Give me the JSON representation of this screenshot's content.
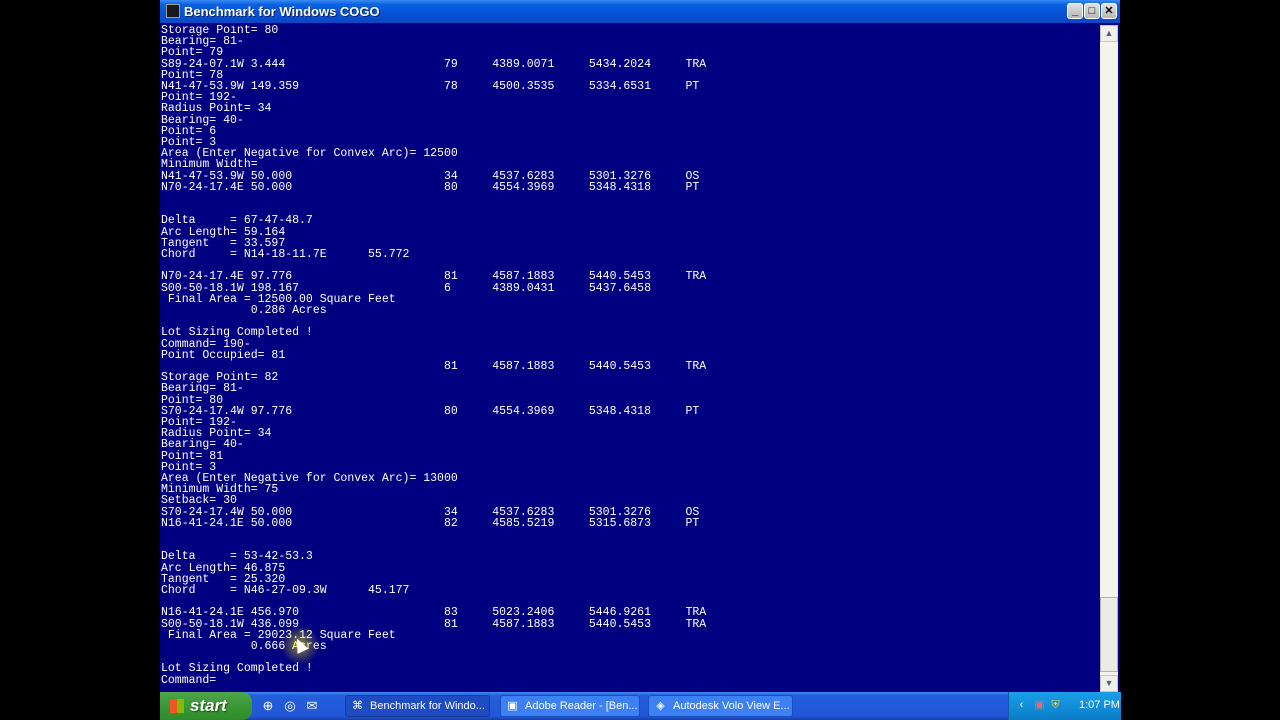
{
  "window": {
    "title": "Benchmark for Windows COGO"
  },
  "titlebar": {
    "minimize": "_",
    "maximize": "□",
    "close": "✕"
  },
  "console": {
    "lines": [
      "Storage Point= 80",
      "Bearing= 81-",
      "Point= 79",
      "S89-24-07.1W 3.444                       79     4389.0071     5434.2024     TRA",
      "Point= 78",
      "N41-47-53.9W 149.359                     78     4500.3535     5334.6531     PT",
      "Point= 192-",
      "Radius Point= 34",
      "Bearing= 40-",
      "Point= 6",
      "Point= 3",
      "Area (Enter Negative for Convex Arc)= 12500",
      "Minimum Width=",
      "N41-47-53.9W 50.000                      34     4537.6283     5301.3276     OS",
      "N70-24-17.4E 50.000                      80     4554.3969     5348.4318     PT",
      "",
      "",
      "Delta     = 67-47-48.7",
      "Arc Length= 59.164",
      "Tangent   = 33.597",
      "Chord     = N14-18-11.7E      55.772",
      "",
      "N70-24-17.4E 97.776                      81     4587.1883     5440.5453     TRA",
      "S00-50-18.1W 198.167                     6      4389.0431     5437.6458",
      " Final Area = 12500.00 Square Feet",
      "             0.286 Acres",
      "",
      "Lot Sizing Completed !",
      "Command= 190-",
      "Point Occupied= 81",
      "                                         81     4587.1883     5440.5453     TRA",
      "Storage Point= 82",
      "Bearing= 81-",
      "Point= 80",
      "S70-24-17.4W 97.776                      80     4554.3969     5348.4318     PT",
      "Point= 192-",
      "Radius Point= 34",
      "Bearing= 40-",
      "Point= 81",
      "Point= 3",
      "Area (Enter Negative for Convex Arc)= 13000",
      "Minimum Width= 75",
      "Setback= 30",
      "S70-24-17.4W 50.000                      34     4537.6283     5301.3276     OS",
      "N16-41-24.1E 50.000                      82     4585.5219     5315.6873     PT",
      "",
      "",
      "Delta     = 53-42-53.3",
      "Arc Length= 46.875",
      "Tangent   = 25.320",
      "Chord     = N46-27-09.3W      45.177",
      "",
      "N16-41-24.1E 456.970                     83     5023.2406     5446.9261     TRA",
      "S00-50-18.1W 436.099                     81     4587.1883     5440.5453     TRA",
      " Final Area = 29023.12 Square Feet",
      "             0.666 Acres",
      "",
      "Lot Sizing Completed !",
      "Command="
    ]
  },
  "scrollbar": {
    "up": "▲",
    "down": "▼"
  },
  "taskbar": {
    "start_label": "start",
    "quicklaunch": [
      "⊕",
      "◎",
      "✉"
    ],
    "tasks": [
      {
        "label": "Benchmark for Windo...",
        "icon": "⌘"
      },
      {
        "label": "Adobe Reader - [Ben...",
        "icon": "▣"
      },
      {
        "label": "Autodesk Volo View E...",
        "icon": "◈"
      }
    ],
    "tray": {
      "chevron": "‹",
      "pdf": "▣",
      "shield": "⛨",
      "clock": "1:07 PM"
    }
  }
}
